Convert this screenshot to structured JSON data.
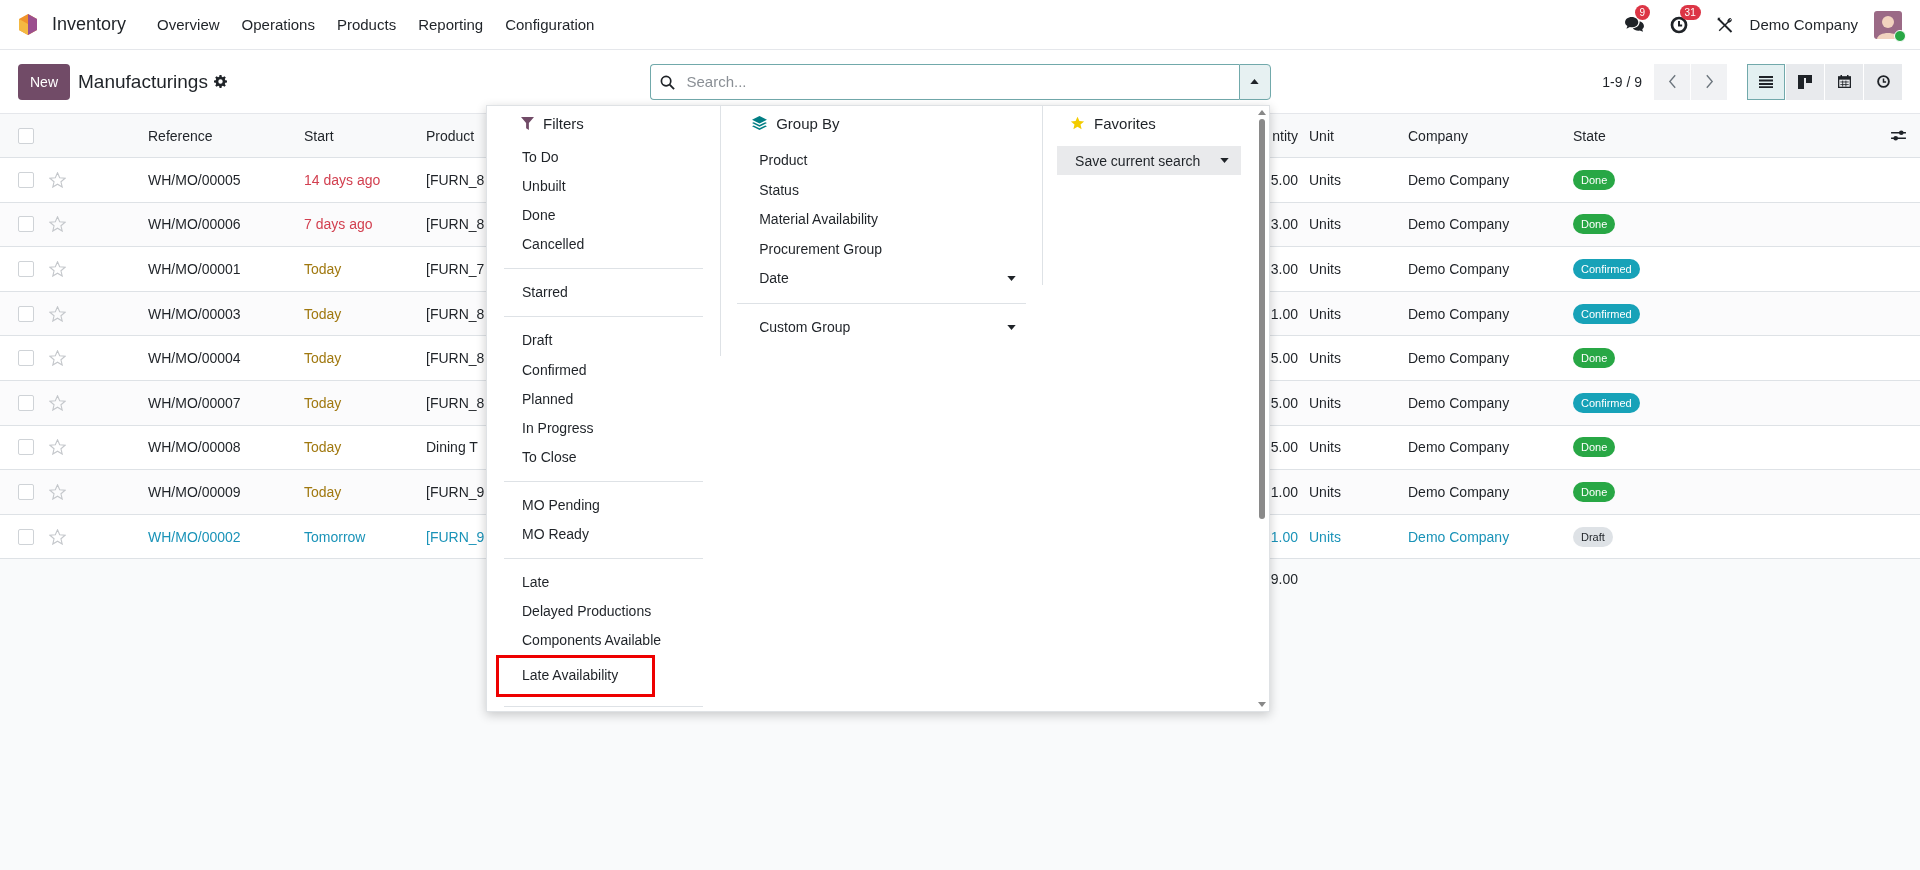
{
  "app": {
    "name": "Inventory"
  },
  "menu": [
    "Overview",
    "Operations",
    "Products",
    "Reporting",
    "Configuration"
  ],
  "systray": {
    "messages_count": "9",
    "activities_count": "31",
    "company": "Demo Company",
    "avatar_online": true
  },
  "control_panel": {
    "new_button": "New",
    "title": "Manufacturings",
    "search": {
      "placeholder": "Search...",
      "panel_open": true
    },
    "pager": "1-9 / 9",
    "views": [
      {
        "kind": "list",
        "selected": true
      },
      {
        "kind": "kanban",
        "selected": false
      },
      {
        "kind": "calendar",
        "selected": false
      },
      {
        "kind": "activity",
        "selected": false
      }
    ]
  },
  "table": {
    "all_checked": false,
    "columns": [
      "Reference",
      "Start",
      "Product",
      "ntity",
      "Unit",
      "Company",
      "State"
    ],
    "rows": [
      {
        "checked": false,
        "starred": false,
        "info": false,
        "reference": "WH/MO/00005",
        "start": {
          "text": "14 days ago",
          "color": "#d23f4f"
        },
        "product": "[FURN_8",
        "quantity": "5.00",
        "unit": "Units",
        "company": "Demo Company",
        "state": {
          "label": "Done",
          "color": "#28a745"
        }
      },
      {
        "checked": false,
        "starred": false,
        "info": false,
        "reference": "WH/MO/00006",
        "start": {
          "text": "7 days ago",
          "color": "#d23f4f"
        },
        "product": "[FURN_8",
        "quantity": "3.00",
        "unit": "Units",
        "company": "Demo Company",
        "state": {
          "label": "Done",
          "color": "#28a745"
        }
      },
      {
        "checked": false,
        "starred": false,
        "info": false,
        "reference": "WH/MO/00001",
        "start": {
          "text": "Today",
          "color": "#a0780f"
        },
        "product": "[FURN_7",
        "quantity": "3.00",
        "unit": "Units",
        "company": "Demo Company",
        "state": {
          "label": "Confirmed",
          "color": "#17a2b8"
        }
      },
      {
        "checked": false,
        "starred": false,
        "info": false,
        "reference": "WH/MO/00003",
        "start": {
          "text": "Today",
          "color": "#a0780f"
        },
        "product": "[FURN_8",
        "quantity": "1.00",
        "unit": "Units",
        "company": "Demo Company",
        "state": {
          "label": "Confirmed",
          "color": "#17a2b8"
        }
      },
      {
        "checked": false,
        "starred": false,
        "info": false,
        "reference": "WH/MO/00004",
        "start": {
          "text": "Today",
          "color": "#a0780f"
        },
        "product": "[FURN_8",
        "quantity": "5.00",
        "unit": "Units",
        "company": "Demo Company",
        "state": {
          "label": "Done",
          "color": "#28a745"
        }
      },
      {
        "checked": false,
        "starred": false,
        "info": false,
        "reference": "WH/MO/00007",
        "start": {
          "text": "Today",
          "color": "#a0780f"
        },
        "product": "[FURN_8",
        "quantity": "5.00",
        "unit": "Units",
        "company": "Demo Company",
        "state": {
          "label": "Confirmed",
          "color": "#17a2b8"
        }
      },
      {
        "checked": false,
        "starred": false,
        "info": false,
        "reference": "WH/MO/00008",
        "start": {
          "text": "Today",
          "color": "#a0780f"
        },
        "product": "Dining T",
        "quantity": "5.00",
        "unit": "Units",
        "company": "Demo Company",
        "state": {
          "label": "Done",
          "color": "#28a745"
        }
      },
      {
        "checked": false,
        "starred": false,
        "info": false,
        "reference": "WH/MO/00009",
        "start": {
          "text": "Today",
          "color": "#a0780f"
        },
        "product": "[FURN_9",
        "quantity": "1.00",
        "unit": "Units",
        "company": "Demo Company",
        "state": {
          "label": "Done",
          "color": "#28a745"
        }
      },
      {
        "checked": false,
        "starred": false,
        "info": true,
        "reference": "WH/MO/00002",
        "start": {
          "text": "Tomorrow",
          "color": "#1a93b8"
        },
        "product": "[FURN_9",
        "quantity": "1.00",
        "unit": "Units",
        "company": "Demo Company",
        "state": {
          "label": "Draft",
          "color": "#dee2e6"
        }
      }
    ],
    "total": "9.00"
  },
  "search_panel": {
    "filters": {
      "title": "Filters",
      "groups": [
        [
          {
            "label": "To Do",
            "highlighted": false
          },
          {
            "label": "Unbuilt",
            "highlighted": false
          },
          {
            "label": "Done",
            "highlighted": false
          },
          {
            "label": "Cancelled",
            "highlighted": false
          }
        ],
        [
          {
            "label": "Starred",
            "highlighted": false
          }
        ],
        [
          {
            "label": "Draft",
            "highlighted": false
          },
          {
            "label": "Confirmed",
            "highlighted": false
          },
          {
            "label": "Planned",
            "highlighted": false
          },
          {
            "label": "In Progress",
            "highlighted": false
          },
          {
            "label": "To Close",
            "highlighted": false
          }
        ],
        [
          {
            "label": "MO Pending",
            "highlighted": false
          },
          {
            "label": "MO Ready",
            "highlighted": false
          }
        ],
        [
          {
            "label": "Late",
            "highlighted": false
          },
          {
            "label": "Delayed Productions",
            "highlighted": false
          },
          {
            "label": "Components Available",
            "highlighted": false
          },
          {
            "label": "Late Availability",
            "highlighted": true
          }
        ]
      ]
    },
    "group_by": {
      "title": "Group By",
      "groups": [
        [
          {
            "label": "Product",
            "submenu": false
          },
          {
            "label": "Status",
            "submenu": false
          },
          {
            "label": "Material Availability",
            "submenu": false
          },
          {
            "label": "Procurement Group",
            "submenu": false
          },
          {
            "label": "Date",
            "submenu": true
          }
        ],
        [
          {
            "label": "Custom Group",
            "submenu": true
          }
        ]
      ]
    },
    "favorites": {
      "title": "Favorites",
      "save_button": "Save current search"
    }
  }
}
